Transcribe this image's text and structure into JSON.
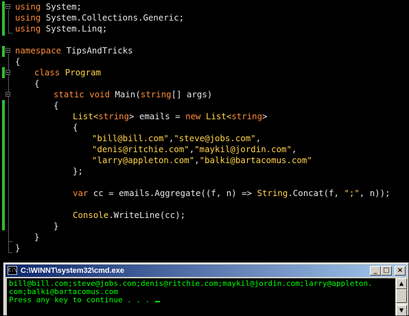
{
  "code": {
    "line1": {
      "kw": "using",
      "rest": " System;"
    },
    "line2": {
      "kw": "using",
      "rest": " System.Collections.Generic;"
    },
    "line3": {
      "kw": "using",
      "rest": " System.Linq;"
    },
    "line4": {
      "kw": "namespace",
      "rest": " TipsAndTricks"
    },
    "line5": "{",
    "line6": {
      "kw": "class",
      "name": "Program"
    },
    "line7": "{",
    "line8": {
      "kw1": "static",
      "kw2": "void",
      "name": "Main(",
      "type": "string",
      "rest": "[] args)"
    },
    "line9": "{",
    "line10": {
      "t1": "List<",
      "ty1": "string",
      "t2": "> emails = ",
      "kw": "new",
      "t3": "List<",
      "ty2": "string",
      "t4": ">"
    },
    "line11": "{",
    "line12": {
      "s1": "\"bill@bill.com\"",
      "s2": "\"steve@jobs.com\""
    },
    "line13": {
      "s1": "\"denis@ritchie.com\"",
      "s2": "\"maykil@jordin.com\""
    },
    "line14": {
      "s1": "\"larry@appleton.com\"",
      "s2": "\"balki@bartacomus.com\""
    },
    "line15": "};",
    "line16": {
      "kw": "var",
      "t1": " cc = emails.Aggregate((f, n) => ",
      "ty": "String",
      "t2": ".Concat(f, ",
      "s": "\";\"",
      "t3": ", n));"
    },
    "line17": {
      "ty": "Console",
      "t": ".WriteLine(cc);"
    },
    "line18": "}",
    "line19": "}",
    "line20": "}",
    "comma": ","
  },
  "console": {
    "icon_text": "C:\\",
    "title": "C:\\WINNT\\system32\\cmd.exe",
    "minimize": "_",
    "maximize": "□",
    "close": "×",
    "output": [
      "bill@bill.com;steve@jobs.com;denis@ritchie.com;maykil@jordin.com;larry@appleton.",
      "com;balki@bartacomus.com",
      "Press any key to continue . . . "
    ],
    "scroll_up": "▲",
    "scroll_down": "▼"
  },
  "colors": {
    "keyword": "#ff8c3a",
    "type": "#ffd24a",
    "text": "#e6e6e6",
    "console_text": "#00ff00",
    "gutter_changed": "#2fbf2f",
    "titlebar": "#0a246a"
  }
}
